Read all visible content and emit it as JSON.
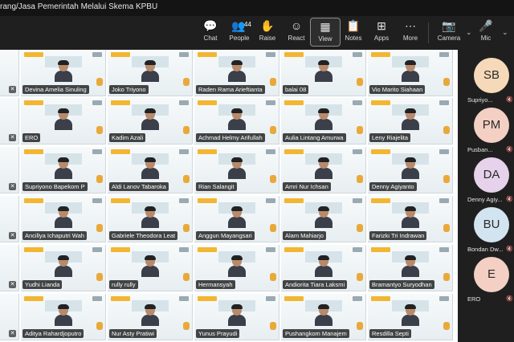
{
  "window": {
    "title": "rang/Jasa Pemerintah Melalui Skema KPBU"
  },
  "toolbar": {
    "chat": "Chat",
    "people": "People",
    "people_count": "44",
    "raise": "Raise",
    "react": "React",
    "view": "View",
    "notes": "Notes",
    "apps": "Apps",
    "more": "More",
    "camera": "Camera",
    "mic": "Mic"
  },
  "tiles": [
    {
      "name": "Devina Amelia Sinuling"
    },
    {
      "name": "Joko Triyono"
    },
    {
      "name": "Raden Rama Arieftianta"
    },
    {
      "name": "balai 08"
    },
    {
      "name": "Vio Marito Siahaan"
    },
    {
      "name": "ERO"
    },
    {
      "name": "Kadim Azali"
    },
    {
      "name": "Achmad Helmy Arifullah"
    },
    {
      "name": "Aulia Lintang Amurwa"
    },
    {
      "name": "Leny Riajelita"
    },
    {
      "name": "Supriyono Bapekom P"
    },
    {
      "name": "Aldi Lanov Tabaroka"
    },
    {
      "name": "Rian Salangit"
    },
    {
      "name": "Amri Nur Ichsan"
    },
    {
      "name": "Denny Agiyanto"
    },
    {
      "name": "Ancillya Ichaputri Wah"
    },
    {
      "name": "Gabriele Theodora Leat"
    },
    {
      "name": "Anggun Mayangsari"
    },
    {
      "name": "Alam Mahiarjo"
    },
    {
      "name": "Farizki Tri Indrawan"
    },
    {
      "name": "Yudhi Lianda"
    },
    {
      "name": "rully rully"
    },
    {
      "name": "Hermansyah"
    },
    {
      "name": "Andiorita Tiara Laksmi"
    },
    {
      "name": "Bramantyo Suryodhan"
    },
    {
      "name": "Aditya Rahardjoputro"
    },
    {
      "name": "Nur Asty Pratiwi"
    },
    {
      "name": "Yunus Prayudi"
    },
    {
      "name": "Pushangkom Manajem"
    },
    {
      "name": "Resdilla Septi"
    }
  ],
  "sidebar_participants": [
    {
      "initials": "SB",
      "name": "Supriyo...",
      "color": "#f6d9b8"
    },
    {
      "initials": "PM",
      "name": "Pusban...",
      "color": "#f3cfc4"
    },
    {
      "initials": "DA",
      "name": "Denny Agiy...",
      "color": "#e6d2ea"
    },
    {
      "initials": "BU",
      "name": "Bondan Dw...",
      "color": "#d3e4f1"
    },
    {
      "initials": "E",
      "name": "ERO",
      "color": "#f3cfc4"
    }
  ],
  "colors": {
    "accent_yellow": "#f2b632",
    "bg_dark": "#1f1f1f"
  }
}
